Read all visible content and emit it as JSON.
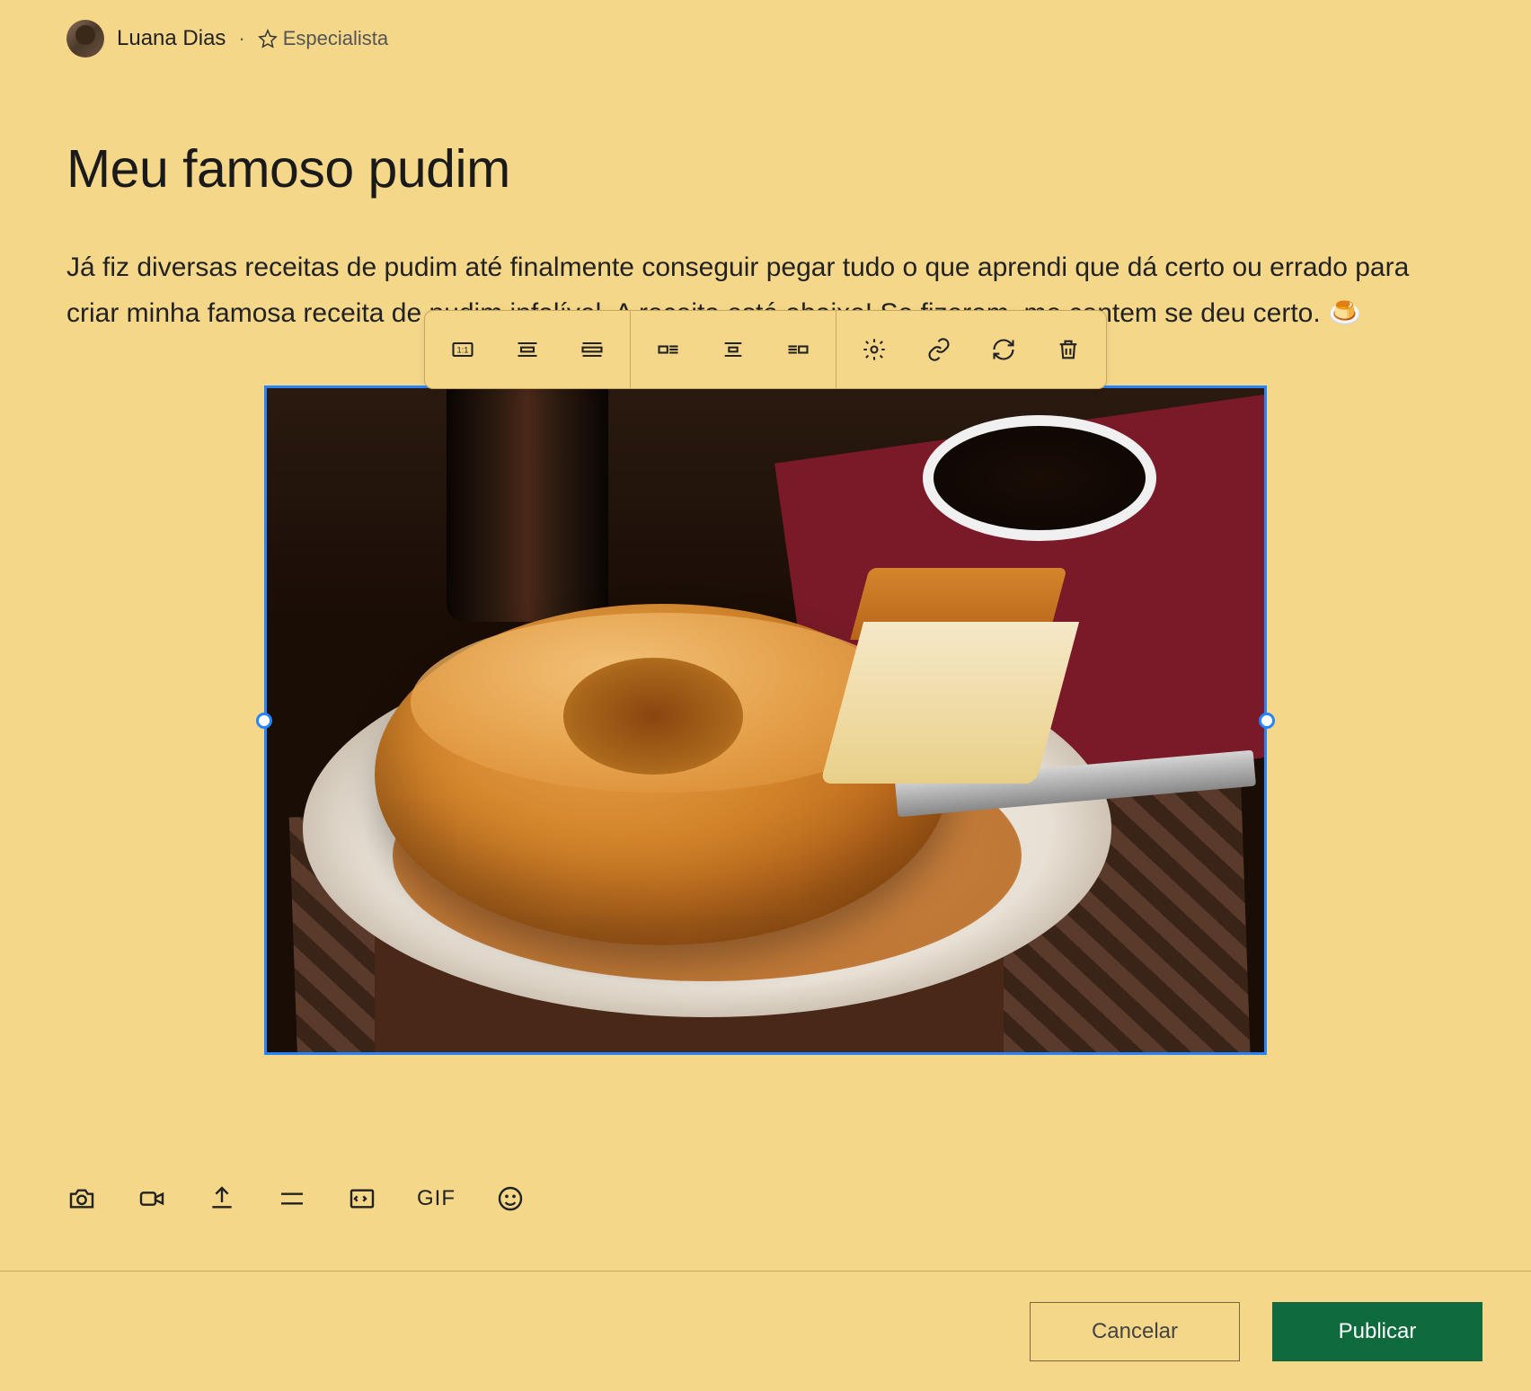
{
  "author": {
    "name": "Luana Dias",
    "badge_label": "Especialista"
  },
  "post": {
    "title": "Meu famoso pudim",
    "body": "Já fiz diversas receitas de pudim até finalmente conseguir pegar tudo o que aprendi que dá certo ou errado para criar minha famosa receita de pudim infalível. A receita está abaixo! Se fizerem, me contem se deu certo. 🍮"
  },
  "image_toolbar": {
    "original_size": "Tamanho original",
    "best_fit": "Melhor ajuste",
    "full_width": "Largura total",
    "align_left": "Alinhar à esquerda",
    "align_center": "Centralizar",
    "align_right": "Alinhar à direita",
    "settings": "Configurações",
    "link": "Adicionar link",
    "replace": "Substituir imagem",
    "delete": "Excluir"
  },
  "attach_bar": {
    "camera": "Foto",
    "video": "Vídeo",
    "upload": "Upload",
    "divider": "Divisor",
    "code": "Código",
    "gif": "GIF",
    "emoji": "Emoji"
  },
  "footer": {
    "cancel": "Cancelar",
    "publish": "Publicar"
  },
  "colors": {
    "background": "#f5d78a",
    "primary": "#0f6b3e",
    "selection": "#2684ff"
  }
}
